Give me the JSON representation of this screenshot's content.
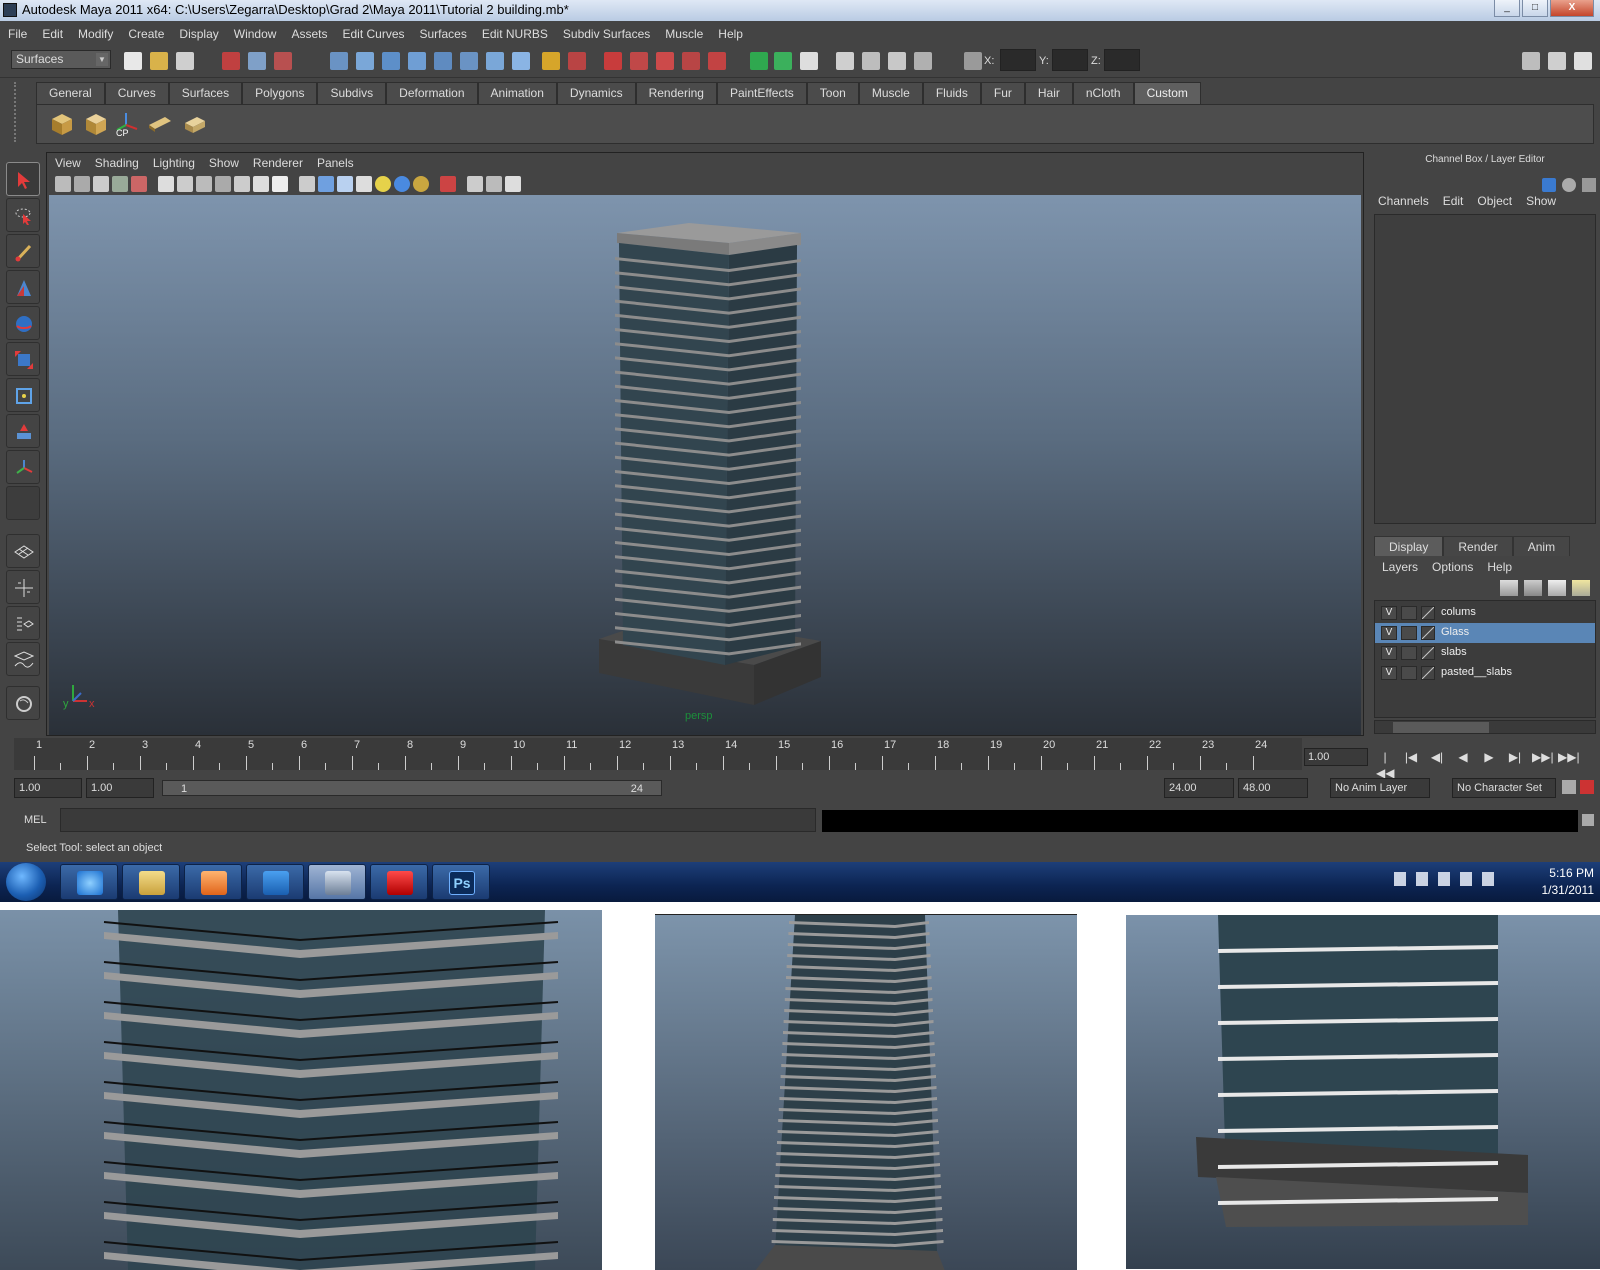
{
  "window": {
    "title": "Autodesk Maya 2011 x64: C:\\Users\\Zegarra\\Desktop\\Grad 2\\Maya 2011\\Tutorial 2 building.mb*",
    "buttons": [
      "_",
      "□",
      "X"
    ]
  },
  "menubar": [
    "File",
    "Edit",
    "Modify",
    "Create",
    "Display",
    "Window",
    "Assets",
    "Edit Curves",
    "Surfaces",
    "Edit NURBS",
    "Subdiv Surfaces",
    "Muscle",
    "Help"
  ],
  "statusline": {
    "mode": "Surfaces",
    "coord_labels": [
      "X:",
      "Y:",
      "Z:"
    ]
  },
  "shelf": {
    "tabs": [
      "General",
      "Curves",
      "Surfaces",
      "Polygons",
      "Subdivs",
      "Deformation",
      "Animation",
      "Dynamics",
      "Rendering",
      "PaintEffects",
      "Toon",
      "Muscle",
      "Fluids",
      "Fur",
      "Hair",
      "nCloth",
      "Custom"
    ],
    "active_tab": "Custom",
    "cp_label": "CP"
  },
  "viewport": {
    "menu": [
      "View",
      "Shading",
      "Lighting",
      "Show",
      "Renderer",
      "Panels"
    ],
    "camera_label": "persp",
    "axis_labels": [
      "y",
      "x"
    ]
  },
  "channel_box": {
    "title": "Channel Box / Layer Editor",
    "menu": [
      "Channels",
      "Edit",
      "Object",
      "Show"
    ]
  },
  "layer_editor": {
    "tabs": [
      "Display",
      "Render",
      "Anim"
    ],
    "active_tab": "Display",
    "menu": [
      "Layers",
      "Options",
      "Help"
    ],
    "visibility_mark": "V",
    "layers": [
      {
        "name": "colums",
        "selected": false
      },
      {
        "name": "Glass",
        "selected": true
      },
      {
        "name": "slabs",
        "selected": false
      },
      {
        "name": "pasted__slabs",
        "selected": false
      }
    ]
  },
  "timeline": {
    "ticks": [
      "1",
      "2",
      "3",
      "4",
      "5",
      "6",
      "7",
      "8",
      "9",
      "10",
      "11",
      "12",
      "13",
      "14",
      "15",
      "16",
      "17",
      "18",
      "19",
      "20",
      "21",
      "22",
      "23",
      "24"
    ],
    "current_frame": "1.00",
    "play_controls": [
      "|◀◀",
      "|◀",
      "◀|",
      "◀",
      "▶",
      "▶|",
      "▶▶|",
      "▶▶|"
    ]
  },
  "range": {
    "start_time": "1.00",
    "playback_start": "1.00",
    "slider_start": "1",
    "slider_end": "24",
    "playback_end": "24.00",
    "end_time": "48.00",
    "anim_layer": "No Anim Layer",
    "character_set": "No Character Set"
  },
  "command": {
    "label": "MEL"
  },
  "helpline": "Select Tool: select an object",
  "taskbar": {
    "time": "5:16 PM",
    "date": "1/31/2011",
    "ps_label": "Ps"
  },
  "colors": {
    "maya_bg": "#444444",
    "selection": "#5a86b6",
    "viewport_top": "#7e94ad",
    "viewport_bottom": "#2a3038",
    "persp_label": "#1c8f3b"
  }
}
